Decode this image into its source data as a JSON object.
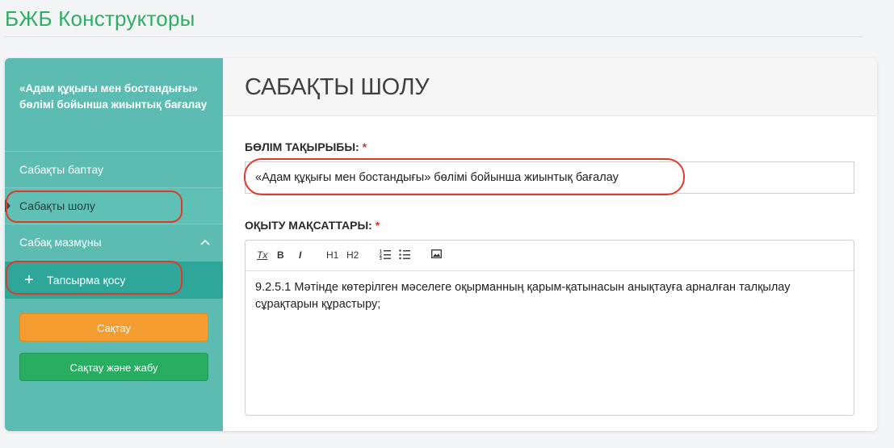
{
  "app": {
    "title": "БЖБ Конструкторы"
  },
  "sidebar": {
    "heading": "«Адам құқығы мен бостандығы» бөлімі бойынша жиынтық бағалау",
    "items": [
      {
        "label": "Сабақты баптау"
      },
      {
        "label": "Сабақты шолу",
        "active": true
      },
      {
        "label": "Сабақ мазмұны"
      }
    ],
    "add_task_label": "Тапсырма қосу",
    "save_label": "Сақтау",
    "save_close_label": "Сақтау және жабу"
  },
  "main": {
    "title": "САБАҚТЫ ШОЛУ",
    "section_topic": {
      "label": "БӨЛІМ ТАҚЫРЫБЫ:",
      "required_mark": "*",
      "value": "«Адам құқығы мен бостандығы» бөлімі бойынша жиынтық бағалау"
    },
    "learning_objectives": {
      "label": "ОҚЫТУ МАҚСАТТАРЫ:",
      "required_mark": "*",
      "toolbar": {
        "clear_format": "Tx",
        "bold": "B",
        "italic": "I",
        "h1": "H1",
        "h2": "H2"
      },
      "content": "9.2.5.1 Мәтінде көтерілген мәселеге оқырманның қарым-қатынасын анықтауға арналған талқылау сұрақтарын құрастыру;"
    }
  },
  "colors": {
    "sidebar": "#5cbcb2",
    "accent_green": "#2eae62",
    "orange": "#f39c2f",
    "highlight": "#e0392b"
  }
}
